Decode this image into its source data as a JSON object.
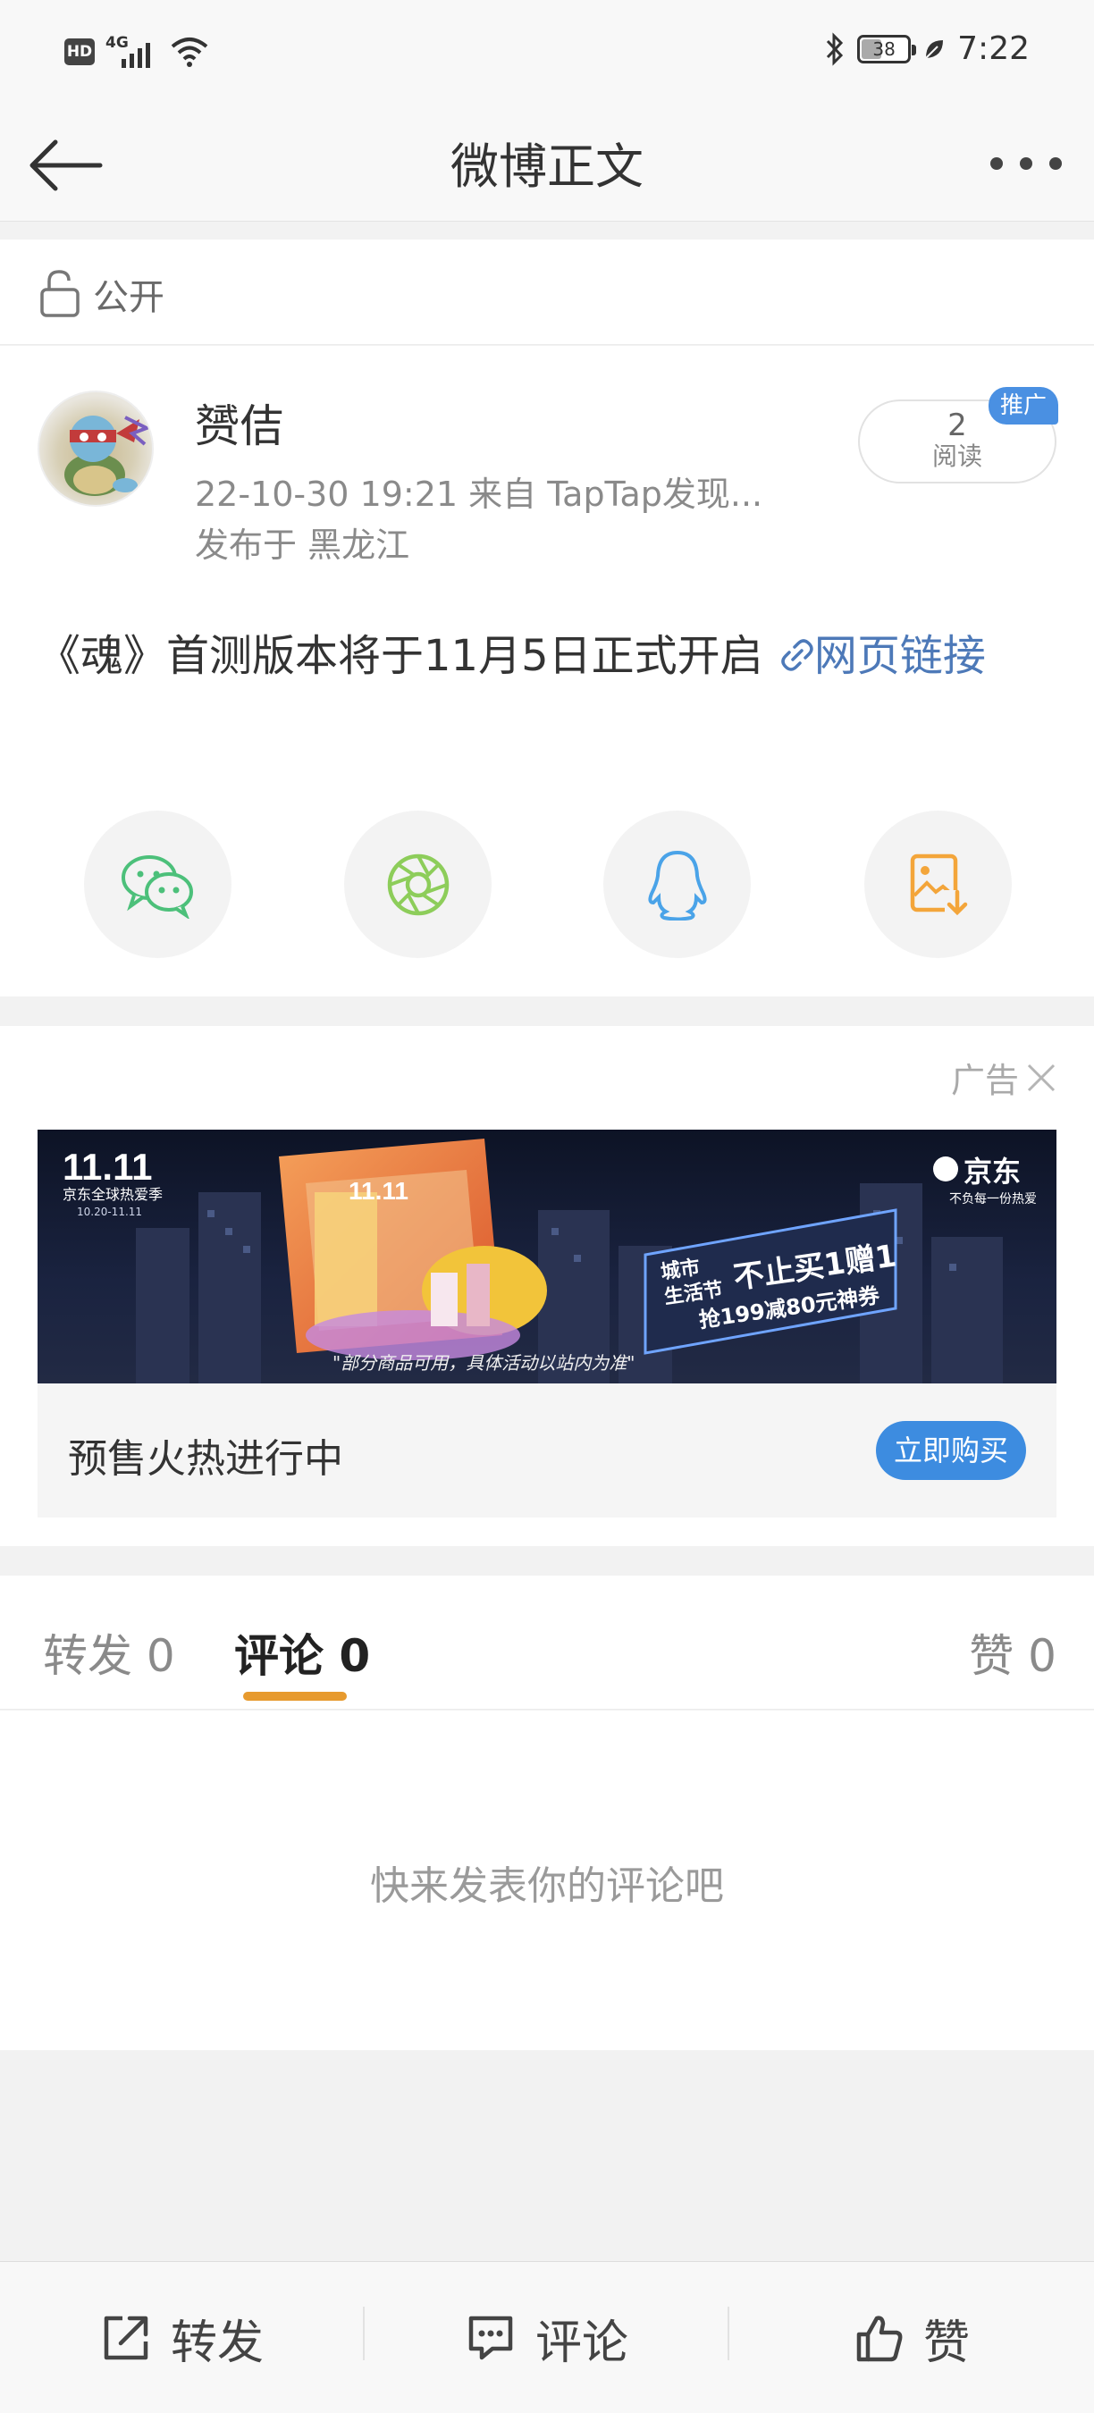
{
  "status_bar": {
    "hd_label": "HD",
    "network_label": "4G",
    "battery_level": "38",
    "time": "7:22",
    "icons": [
      "hd-icon",
      "signal-icon",
      "wifi-icon",
      "bluetooth-icon",
      "battery-icon",
      "leaf-icon"
    ]
  },
  "nav": {
    "title": "微博正文",
    "back_icon": "back-arrow-icon",
    "more_icon": "more-dots-icon"
  },
  "visibility": {
    "icon": "unlock-icon",
    "label": "公开"
  },
  "post": {
    "username": "赟佶",
    "meta": "22-10-30 19:21   来自 TapTap发现...",
    "location": "发布于 黑龙江",
    "reads_count": "2",
    "reads_label": "阅读",
    "promo_badge": "推广",
    "text": "《魂》首测版本将于11月5日正式开启 ",
    "link_text": "网页链接",
    "link_icon": "link-icon"
  },
  "share": {
    "items": [
      {
        "name": "wechat",
        "icon": "wechat-icon",
        "color": "#4cc07a"
      },
      {
        "name": "moments",
        "icon": "moments-icon",
        "color": "#8dcd5a"
      },
      {
        "name": "qq",
        "icon": "qq-icon",
        "color": "#4aa3e8"
      },
      {
        "name": "save-image",
        "icon": "save-image-icon",
        "color": "#f3a53a"
      }
    ]
  },
  "ad": {
    "tag": "广告",
    "banner": {
      "event": "11.11",
      "event_sub": "京东全球热爱季",
      "event_date": "10.20-11.11",
      "brand": "京东",
      "brand_slogan": "不负每一份热爱",
      "sign_line1": "城市",
      "sign_line2": "生活节",
      "sign_big": "不止买1赠1",
      "sign_line3": "抢199减80元神券",
      "footnote": "\"部分商品可用，具体活动以站内为准\""
    },
    "caption": "预售火热进行中",
    "cta": "立即购买"
  },
  "tabs": {
    "repost": "转发 0",
    "comment": "评论 0",
    "like": "赞 0",
    "active": "comment"
  },
  "empty_state": "快来发表你的评论吧",
  "bottom_bar": {
    "repost": "转发",
    "comment": "评论",
    "like": "赞"
  },
  "colors": {
    "accent_orange": "#e79a2e",
    "link_blue": "#4d79b8",
    "cta_blue": "#3d8ce0"
  }
}
